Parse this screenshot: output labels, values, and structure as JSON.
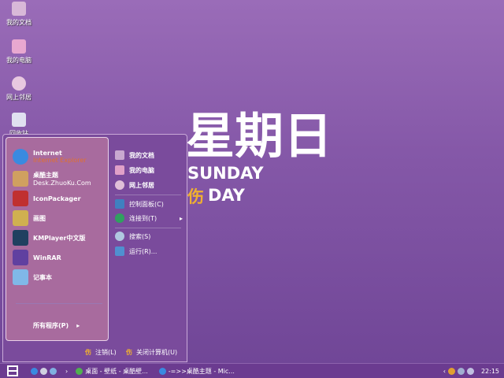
{
  "desktop_icons": [
    {
      "label": "我的文档",
      "icon": "folder-icon"
    },
    {
      "label": "我的电脑",
      "icon": "computer-icon"
    },
    {
      "label": "网上邻居",
      "icon": "network-icon"
    },
    {
      "label": "回收站",
      "icon": "recycle-bin-icon"
    }
  ],
  "wallpaper": {
    "title": "星期日",
    "line1": "SUNDAY",
    "badge": "伤",
    "line2": "DAY"
  },
  "start_menu": {
    "pinned": [
      {
        "label": "Internet",
        "sub": "Internet Explorer"
      },
      {
        "label": "桌酷主题",
        "sub": "Desk.ZhuoKu.Com"
      },
      {
        "label": "IconPackager"
      },
      {
        "label": "画图"
      },
      {
        "label": "KMPlayer中文版"
      },
      {
        "label": "WinRAR"
      },
      {
        "label": "记事本"
      }
    ],
    "all_programs": "所有程序(P)",
    "right": [
      {
        "label": "我的文档"
      },
      {
        "label": "我的电脑"
      },
      {
        "label": "网上邻居"
      },
      {
        "label": "控制面板(C)"
      },
      {
        "label": "连接到(T)"
      },
      {
        "label": "搜索(S)"
      },
      {
        "label": "运行(R)..."
      }
    ],
    "logoff": "注销(L)",
    "shutdown": "关闭计算机(U)"
  },
  "taskbar": {
    "tasks": [
      "桌面 - 壁纸 - 桌酷壁...",
      "-=>>桌酷主题 - Mic..."
    ],
    "clock": "22:15"
  },
  "colors": {
    "accent": "#6b3b90",
    "menu_left": "#a86b9e"
  }
}
